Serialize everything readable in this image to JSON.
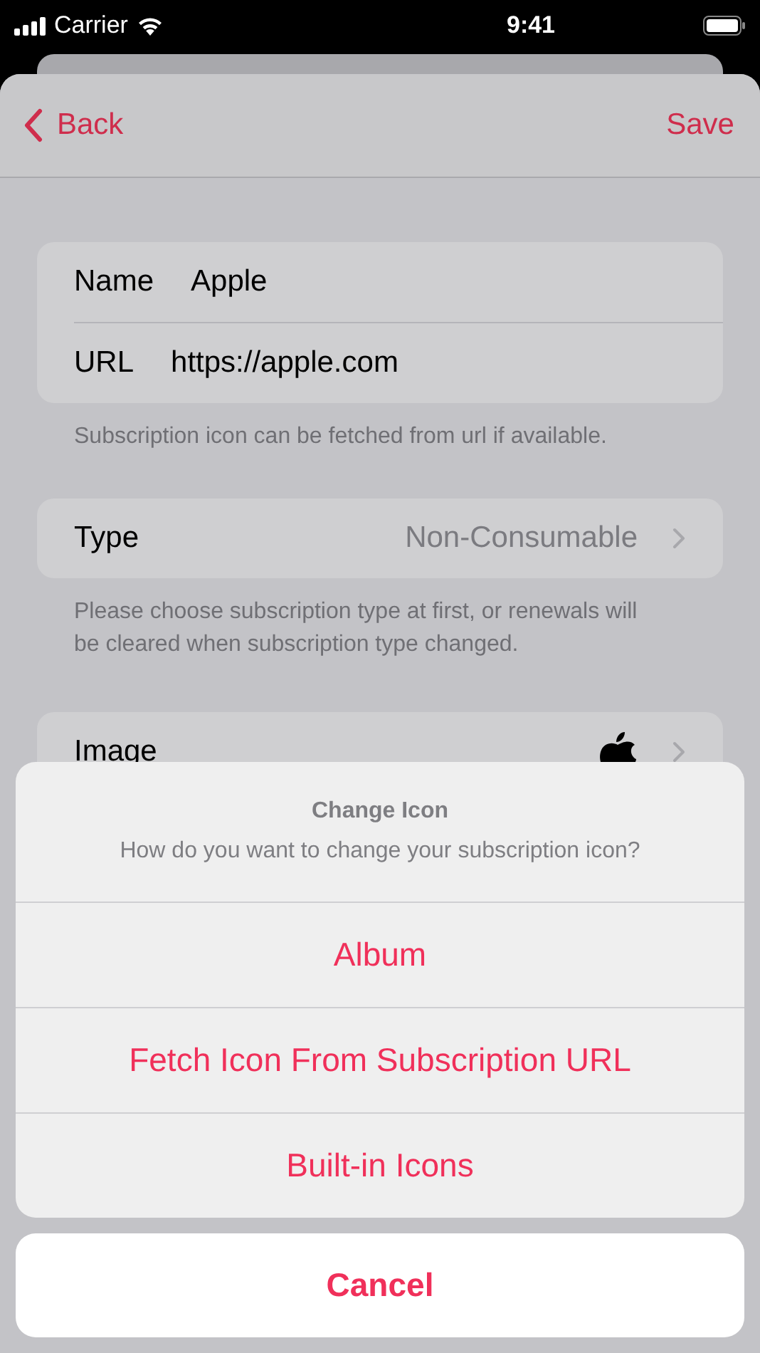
{
  "status_bar": {
    "carrier": "Carrier",
    "time": "9:41"
  },
  "nav": {
    "back": "Back",
    "save": "Save"
  },
  "fields": [
    {
      "label": "Name",
      "value": "Apple"
    },
    {
      "label": "URL",
      "value": "https://apple.com"
    }
  ],
  "fields_footer": "Subscription icon can be fetched from url if available.",
  "type_row": {
    "label": "Type",
    "value": "Non-Consumable"
  },
  "type_footer": "Please choose subscription type at first, or renewals will be cleared when subscription type changed.",
  "image_row": {
    "label": "Image"
  },
  "action_sheet": {
    "title": "Change Icon",
    "message": "How do you want to change your subscription icon?",
    "actions": [
      "Album",
      "Fetch Icon From Subscription URL",
      "Built-in Icons"
    ],
    "cancel": "Cancel"
  }
}
